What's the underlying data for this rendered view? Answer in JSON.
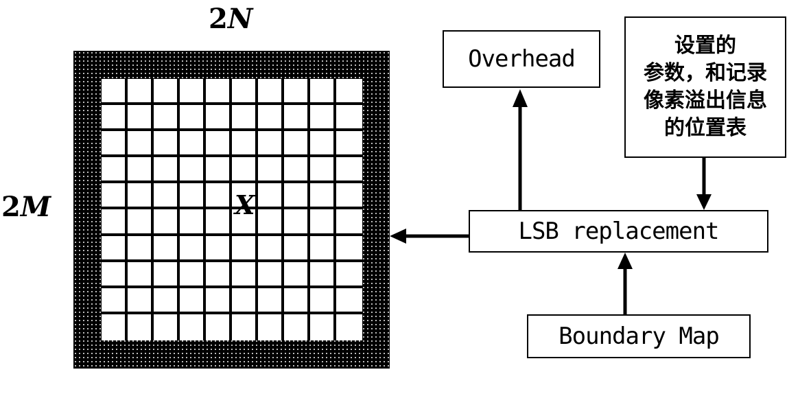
{
  "image_grid": {
    "width_label_prefix": "2",
    "width_label_var": "N",
    "height_label_prefix": "2",
    "height_label_var": "M",
    "center_label": "X",
    "rows": 10,
    "cols": 10
  },
  "boxes": {
    "overhead": "Overhead",
    "parameters_lines": [
      "设置的",
      "参数，和记录",
      "像素溢出信息",
      "的位置表"
    ],
    "lsb": "LSB replacement",
    "boundary_map": "Boundary Map"
  },
  "arrows": [
    {
      "from": "lsb",
      "to": "overhead"
    },
    {
      "from": "parameters",
      "to": "lsb"
    },
    {
      "from": "boundary_map",
      "to": "lsb"
    },
    {
      "from": "lsb",
      "to": "image_grid"
    }
  ]
}
